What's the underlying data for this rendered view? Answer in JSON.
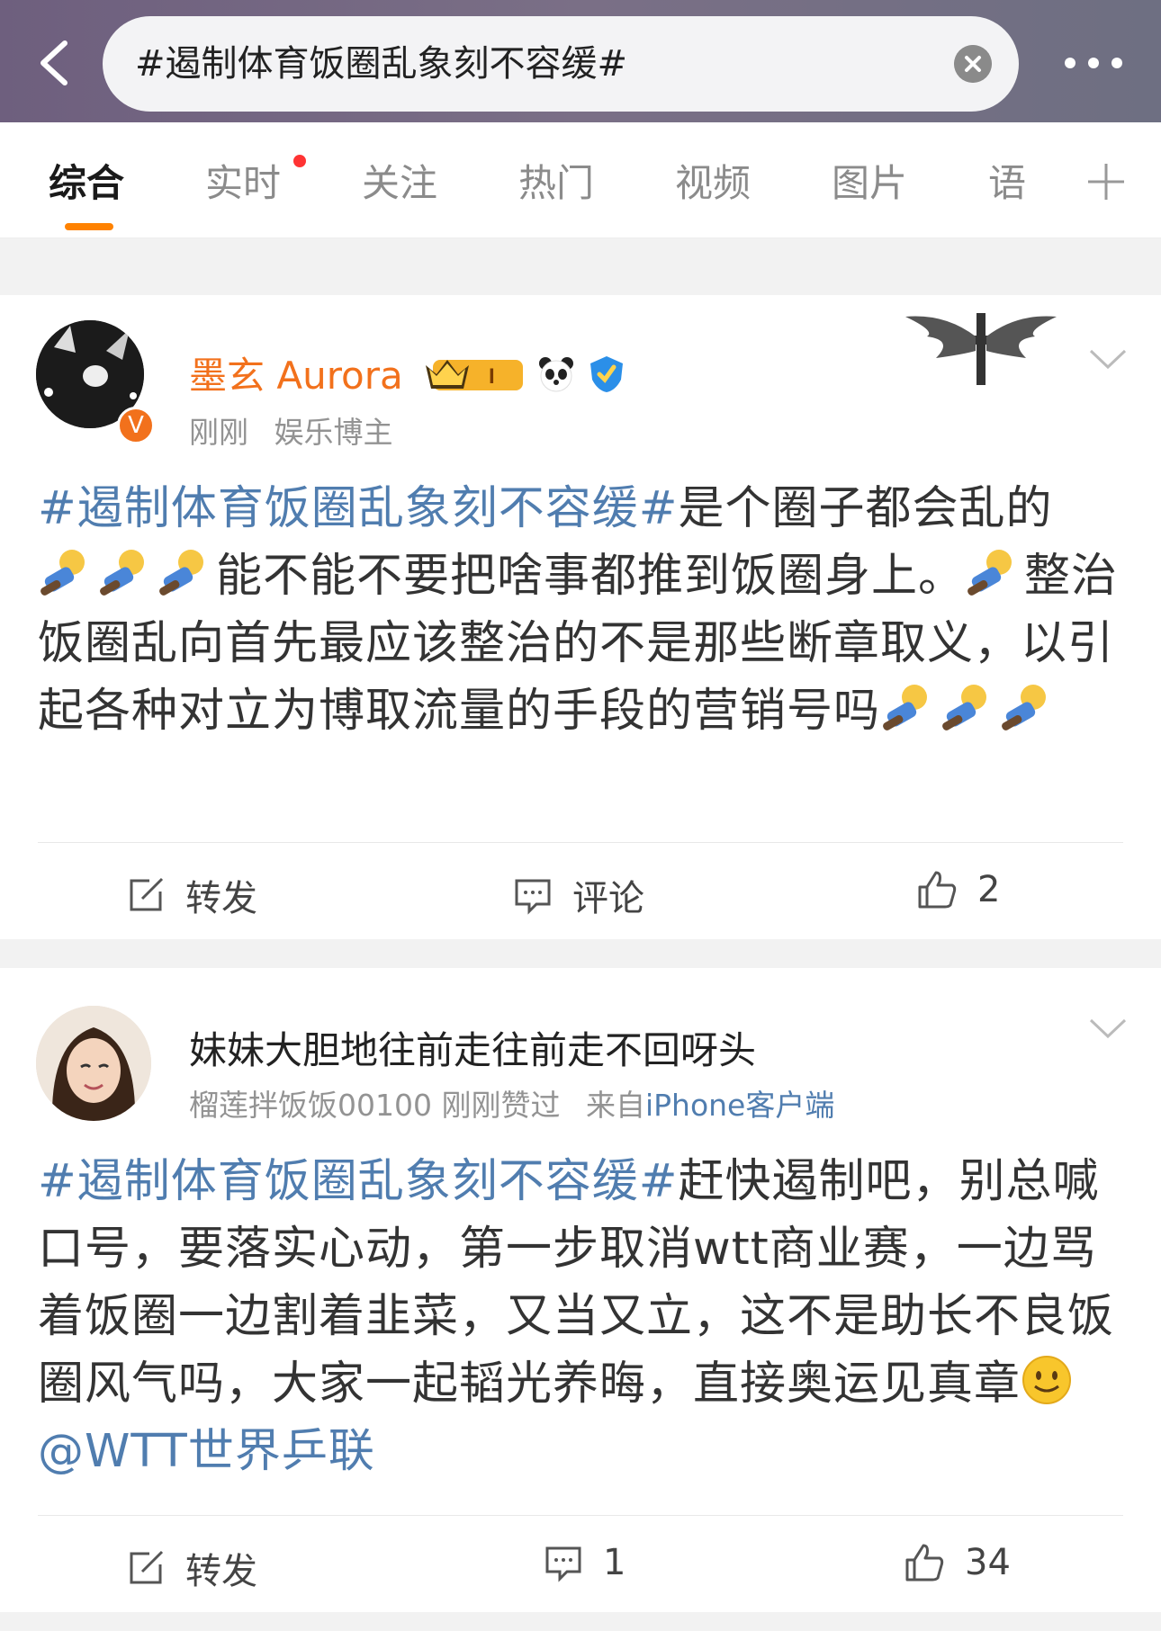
{
  "search": {
    "query": "#遏制体育饭圈乱象刻不容缓#"
  },
  "tabs": [
    "综合",
    "实时",
    "关注",
    "热门",
    "视频",
    "图片",
    "语"
  ],
  "colors": {
    "accent": "#ff8200",
    "topic": "#507daf",
    "author1": "#f2711c",
    "unread_dot": "#ff3333"
  },
  "posts": [
    {
      "author": "墨玄 Aurora",
      "level_badge": "I",
      "time": "刚刚",
      "role": "娱乐博主",
      "topic": "#遏制体育饭圈乱象刻不容缓#",
      "text_a": "是个圈子都会乱的",
      "text_b": "能不能不要把啥事都推到饭圈身上。",
      "text_c": "整治饭圈乱向首先最应该整治的不是那些断章取义，以引起各种对立为博取流量的手段的营销号吗",
      "actions": {
        "repost": "转发",
        "comment": "评论",
        "likes": "2"
      }
    },
    {
      "author": "妹妹大胆地往前走往前走不回呀头",
      "liked_by": "榴莲拌饭饭00100 刚刚赞过",
      "source_prefix": "来自",
      "source": "iPhone客户端",
      "topic": "#遏制体育饭圈乱象刻不容缓#",
      "text_a": "赶快遏制吧，别总喊口号，要落实心动，第一步取消wtt商业赛，一边骂着饭圈一边割着韭菜，又当又立，这不是助长不良饭圈风气吗，大家一起韬光养晦，直接奥运见真章",
      "mention": "@WTT世界乒联",
      "actions": {
        "repost": "转发",
        "comments": "1",
        "likes": "34"
      }
    }
  ]
}
